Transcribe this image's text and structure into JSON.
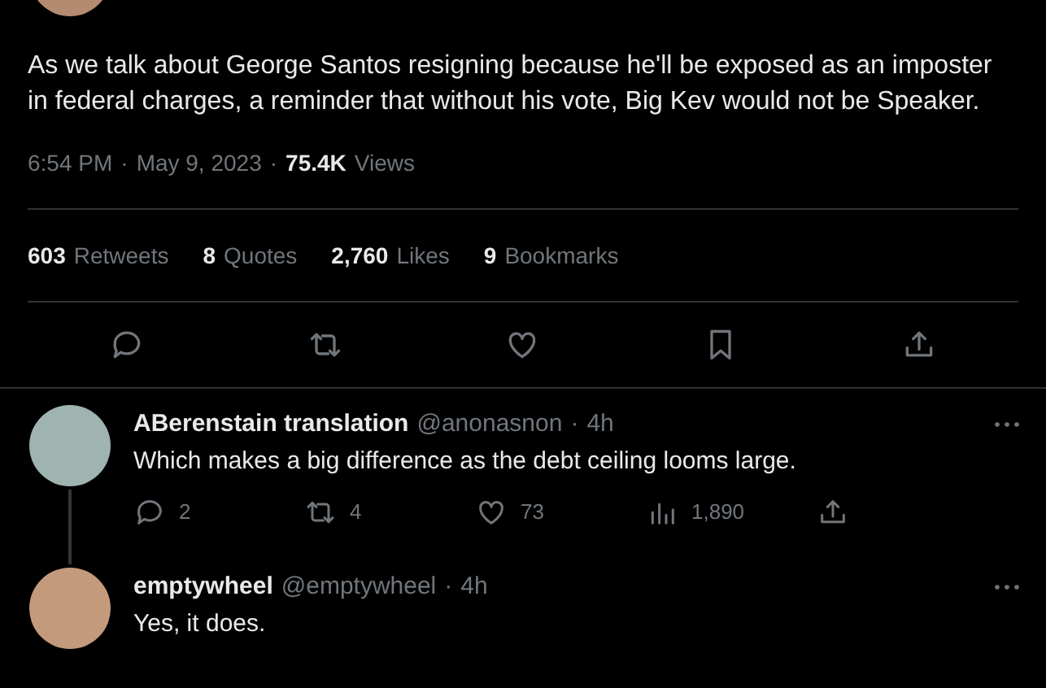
{
  "tweet": {
    "text": "As we talk about George Santos resigning because he'll be exposed as an imposter in federal charges, a reminder that without his vote, Big Kev would not be Speaker.",
    "time": "6:54 PM",
    "separator_1": "·",
    "date": "May 9, 2023",
    "separator_2": "·",
    "views_count": "75.4K",
    "views_label": "Views",
    "stats": [
      {
        "count": "603",
        "label": "Retweets"
      },
      {
        "count": "8",
        "label": "Quotes"
      },
      {
        "count": "2,760",
        "label": "Likes"
      },
      {
        "count": "9",
        "label": "Bookmarks"
      }
    ]
  },
  "replies": [
    {
      "name": "ABerenstain translation",
      "handle": "@anonasnon",
      "separator": "·",
      "age": "4h",
      "text": "Which makes a big difference as the debt ceiling looms large.",
      "thread_line": true,
      "actions": [
        {
          "kind": "reply",
          "count": "2"
        },
        {
          "kind": "retweet",
          "count": "4"
        },
        {
          "kind": "like",
          "count": "73"
        },
        {
          "kind": "views",
          "count": "1,890"
        },
        {
          "kind": "share"
        }
      ]
    },
    {
      "name": "emptywheel",
      "handle": "@emptywheel",
      "separator": "·",
      "age": "4h",
      "text": "Yes, it does.",
      "thread_line": false
    }
  ]
}
